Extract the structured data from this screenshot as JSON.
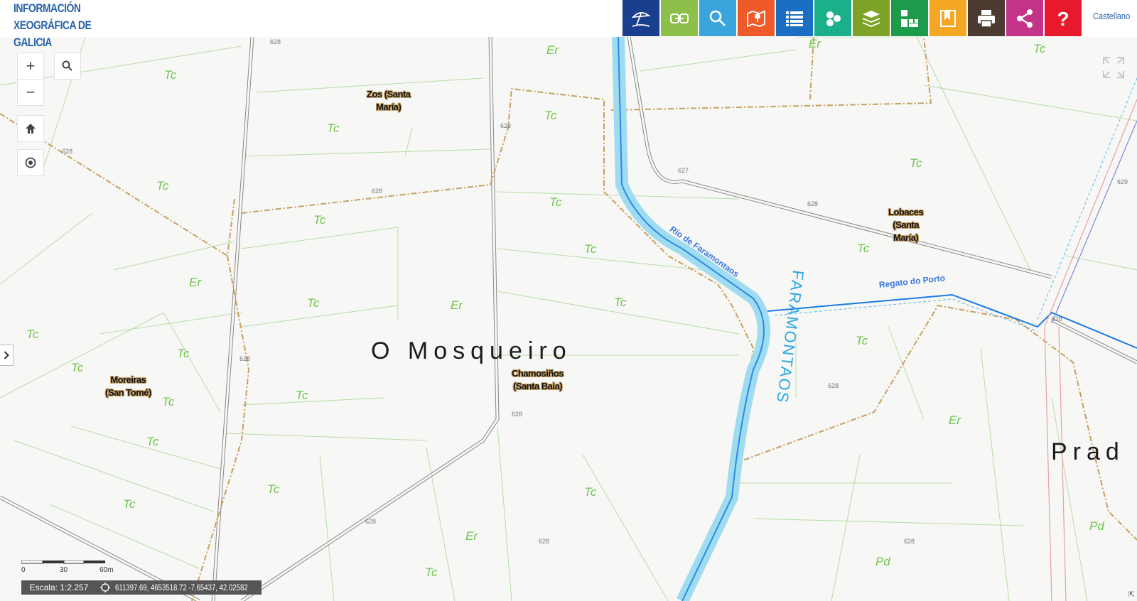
{
  "header": {
    "logo_line1": "INFORMACIÓN",
    "logo_line2": "XEOGRÁFICA DE GALICIA",
    "language": "Castellano",
    "tools": [
      {
        "name": "beach-tool",
        "icon": "beach-umbrella-icon",
        "color": "#1b3f8f"
      },
      {
        "name": "link-tool",
        "icon": "link-icon",
        "color": "#8cc04a"
      },
      {
        "name": "search-tool",
        "icon": "search-icon",
        "color": "#3aa5dc"
      },
      {
        "name": "map-tool",
        "icon": "map-pin-icon",
        "color": "#ef5a2b"
      },
      {
        "name": "list-tool",
        "icon": "list-icon",
        "color": "#1b6fc2"
      },
      {
        "name": "points-tool",
        "icon": "cluster-icon",
        "color": "#1ab08a"
      },
      {
        "name": "layers-tool",
        "icon": "layers-icon",
        "color": "#7da225"
      },
      {
        "name": "tiles-tool",
        "icon": "grid-tiles-icon",
        "color": "#1c9c4a"
      },
      {
        "name": "bookmark-tool",
        "icon": "bookmark-icon",
        "color": "#f5a623"
      },
      {
        "name": "print-tool",
        "icon": "print-icon",
        "color": "#4a3a30"
      },
      {
        "name": "share-tool",
        "icon": "share-icon",
        "color": "#c4338a"
      },
      {
        "name": "help-tool",
        "icon": "help-icon",
        "color": "#e8192c"
      }
    ]
  },
  "controls": {
    "zoom_in": "+",
    "zoom_out": "−"
  },
  "scale": {
    "ticks": [
      "0",
      "30",
      "60m"
    ],
    "label": "Escala: 1:2.257"
  },
  "coordinates": "611397.69, 4653518.72  -7.65437, 42.02582",
  "map": {
    "place_names": [
      "O Mosqueiro",
      "Prad"
    ],
    "parishes": [
      {
        "line1": "Zos (Santa",
        "line2": "María)"
      },
      {
        "line1": "Chamosiños",
        "line2": "(Santa Baia)"
      },
      {
        "line1": "Moreiras",
        "line2": "(San Tomé)"
      },
      {
        "line1": "Lobaces",
        "line2": "(Santa",
        "line3": "María)"
      }
    ],
    "rivers": [
      "Río de Faramontaos",
      "Regato do Porto",
      "FARAMONTAOS"
    ],
    "land_use": [
      "Tc",
      "Er",
      "Pd"
    ],
    "elevation": "628",
    "elevation_alt": [
      "627",
      "629"
    ]
  }
}
